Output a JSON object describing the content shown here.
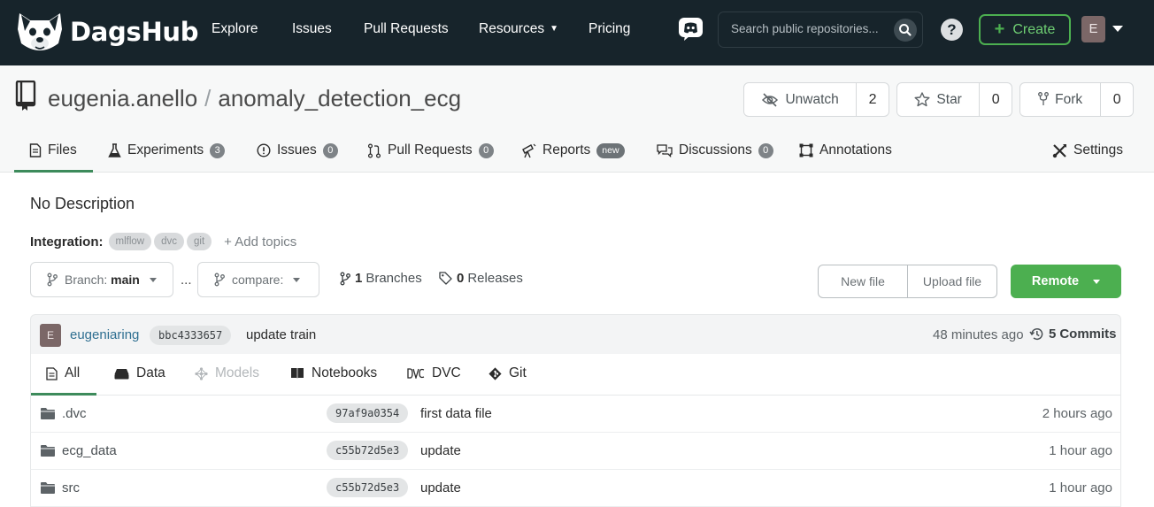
{
  "brand": {
    "name": "DagsHub"
  },
  "nav": {
    "explore": "Explore",
    "issues": "Issues",
    "pull_requests": "Pull Requests",
    "resources": "Resources",
    "pricing": "Pricing"
  },
  "search": {
    "placeholder": "Search public repositories..."
  },
  "help": "?",
  "create": {
    "label": "Create"
  },
  "user": {
    "initial": "E"
  },
  "repo": {
    "owner": "eugenia.anello",
    "separator": "/",
    "name": "anomaly_detection_ecg",
    "watch": {
      "label": "Unwatch",
      "count": "2"
    },
    "star": {
      "label": "Star",
      "count": "0"
    },
    "fork": {
      "label": "Fork",
      "count": "0"
    }
  },
  "tabs": {
    "files": "Files",
    "experiments": {
      "label": "Experiments",
      "count": "3"
    },
    "issues": {
      "label": "Issues",
      "count": "0"
    },
    "pull_requests": {
      "label": "Pull Requests",
      "count": "0"
    },
    "reports": {
      "label": "Reports",
      "badge": "new"
    },
    "discussions": {
      "label": "Discussions",
      "count": "0"
    },
    "annotations": "Annotations",
    "settings": "Settings"
  },
  "description": "No Description",
  "integration": {
    "label": "Integration:",
    "chips": [
      "mlflow",
      "dvc",
      "git"
    ],
    "add_topics": "+ Add topics"
  },
  "branch": {
    "prefix": "Branch:",
    "value": "main"
  },
  "ellipsis": "...",
  "compare": {
    "label": "compare:"
  },
  "branches": {
    "count": "1",
    "label": "Branches"
  },
  "releases": {
    "count": "0",
    "label": "Releases"
  },
  "buttons": {
    "new_file": "New file",
    "upload_file": "Upload file",
    "remote": "Remote"
  },
  "commit": {
    "avatar": "E",
    "user": "eugeniaring",
    "sha": "bbc4333657",
    "message": "update train",
    "time": "48 minutes ago",
    "commits_count": "5",
    "commits_label": "Commits"
  },
  "file_tabs": {
    "all": "All",
    "data": "Data",
    "models": "Models",
    "notebooks": "Notebooks",
    "dvc": "DVC",
    "git": "Git"
  },
  "files": [
    {
      "name": ".dvc",
      "sha": "97af9a0354",
      "message": "first data file",
      "time": "2 hours ago"
    },
    {
      "name": "ecg_data",
      "sha": "c55b72d5e3",
      "message": "update",
      "time": "1 hour ago"
    },
    {
      "name": "src",
      "sha": "c55b72d5e3",
      "message": "update",
      "time": "1 hour ago"
    }
  ],
  "colors": {
    "nav_bg": "#17242b",
    "accent_green": "#4caf50",
    "tab_underline": "#3d8b5b",
    "commit_user": "#2f6f91"
  }
}
